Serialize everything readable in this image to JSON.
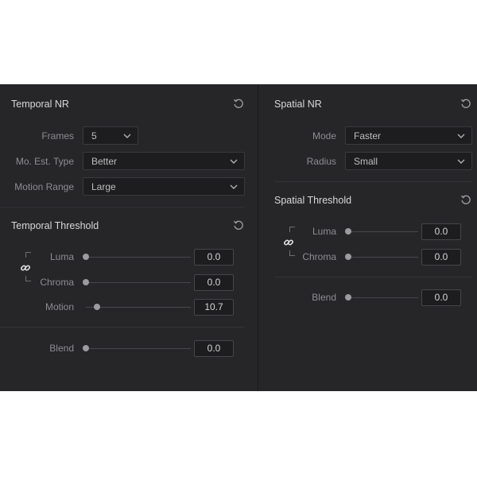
{
  "temporal_nr": {
    "title": "Temporal NR",
    "frames": {
      "label": "Frames",
      "value": "5"
    },
    "mo_est_type": {
      "label": "Mo. Est. Type",
      "value": "Better"
    },
    "motion_range": {
      "label": "Motion Range",
      "value": "Large"
    }
  },
  "temporal_threshold": {
    "title": "Temporal Threshold",
    "luma": {
      "label": "Luma",
      "value": "0.0",
      "level": 0.0
    },
    "chroma": {
      "label": "Chroma",
      "value": "0.0",
      "level": 0.0
    },
    "motion": {
      "label": "Motion",
      "value": "10.7",
      "level": 0.107
    },
    "blend": {
      "label": "Blend",
      "value": "0.0",
      "level": 0.0
    }
  },
  "spatial_nr": {
    "title": "Spatial NR",
    "mode": {
      "label": "Mode",
      "value": "Faster"
    },
    "radius": {
      "label": "Radius",
      "value": "Small"
    }
  },
  "spatial_threshold": {
    "title": "Spatial Threshold",
    "luma": {
      "label": "Luma",
      "value": "0.0",
      "level": 0.0
    },
    "chroma": {
      "label": "Chroma",
      "value": "0.0",
      "level": 0.0
    },
    "blend": {
      "label": "Blend",
      "value": "0.0",
      "level": 0.0
    }
  },
  "icons": {
    "reset": "reset-icon",
    "link": "link-icon",
    "chevron": "chevron-down-icon"
  },
  "colors": {
    "panel_bg": "#262629",
    "field_bg": "#1d1d1f",
    "title_text": "#d8d8da",
    "label_text": "#8d8d92"
  }
}
